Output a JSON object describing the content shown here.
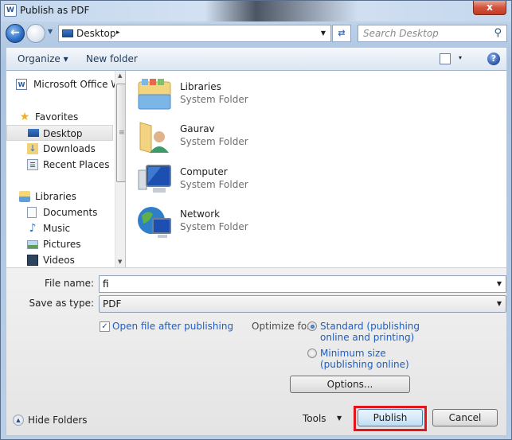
{
  "window": {
    "title": "Publish as PDF",
    "app_icon": "word-icon",
    "close_label": "x"
  },
  "navigation": {
    "back_icon": "back-arrow-icon",
    "forward_icon": "forward-arrow-icon",
    "address": {
      "location": "Desktop",
      "separator": "▸"
    },
    "search": {
      "placeholder": "Search Desktop"
    }
  },
  "toolbar": {
    "organize_label": "Organize ▾",
    "new_folder_label": "New folder",
    "view_dropdown": "▾",
    "help_label": "?"
  },
  "nav_pane": {
    "items": [
      {
        "label": "Microsoft Office W",
        "icon": "word-icon",
        "level": 0
      },
      {
        "label": "Favorites",
        "icon": "star-icon",
        "level": 0
      },
      {
        "label": "Desktop",
        "icon": "desktop-icon",
        "level": 1,
        "selected": true
      },
      {
        "label": "Downloads",
        "icon": "downloads-icon",
        "level": 1
      },
      {
        "label": "Recent Places",
        "icon": "recent-places-icon",
        "level": 1
      },
      {
        "label": "Libraries",
        "icon": "libraries-icon",
        "level": 0
      },
      {
        "label": "Documents",
        "icon": "documents-icon",
        "level": 1
      },
      {
        "label": "Music",
        "icon": "music-icon",
        "level": 1
      },
      {
        "label": "Pictures",
        "icon": "pictures-icon",
        "level": 1
      },
      {
        "label": "Videos",
        "icon": "videos-icon",
        "level": 1
      }
    ]
  },
  "content": {
    "items": [
      {
        "name": "Libraries",
        "type": "System Folder",
        "icon": "libraries-folder-icon"
      },
      {
        "name": "Gaurav",
        "type": "System Folder",
        "icon": "user-folder-icon"
      },
      {
        "name": "Computer",
        "type": "System Folder",
        "icon": "computer-icon"
      },
      {
        "name": "Network",
        "type": "System Folder",
        "icon": "network-icon"
      }
    ]
  },
  "form": {
    "file_name_label": "File name:",
    "file_name_value": "fi",
    "save_type_label": "Save as type:",
    "save_type_value": "PDF",
    "open_after_label": "Open file after publishing",
    "open_after_checked": true,
    "optimize_label": "Optimize for:",
    "optimize_options": [
      {
        "line1": "Standard (publishing",
        "line2": "online and printing)",
        "checked": true
      },
      {
        "line1": "Minimum size",
        "line2": "(publishing online)",
        "checked": false
      }
    ],
    "options_button": "Options..."
  },
  "footer": {
    "hide_folders_label": "Hide Folders",
    "tools_label": "Tools",
    "publish_button": "Publish",
    "cancel_button": "Cancel"
  },
  "colors": {
    "link_blue": "#1c5ec4",
    "highlight_red": "#e3141c"
  }
}
